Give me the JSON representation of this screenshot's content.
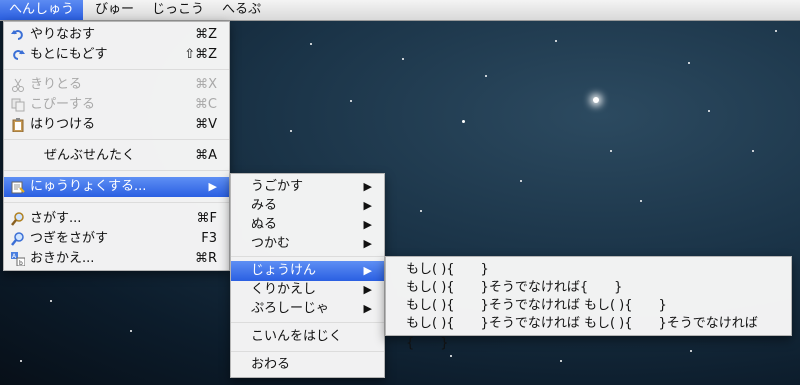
{
  "menubar": [
    "へんしゅう",
    "びゅー",
    "じっこう",
    "へるぷ"
  ],
  "edit_menu": {
    "undo": {
      "label": "やりなおす",
      "shortcut": "⌘Z",
      "icon": "undo-icon"
    },
    "redo": {
      "label": "もとにもどす",
      "shortcut": "⇧⌘Z",
      "icon": "redo-icon"
    },
    "cut": {
      "label": "きりとる",
      "shortcut": "⌘X",
      "icon": "scissors-icon"
    },
    "copy": {
      "label": "こぴーする",
      "shortcut": "⌘C",
      "icon": "copy-icon"
    },
    "paste": {
      "label": "はりつける",
      "shortcut": "⌘V",
      "icon": "clipboard-icon"
    },
    "select_all": {
      "label": "ぜんぶせんたく",
      "shortcut": "⌘A"
    },
    "insert": {
      "label": "にゅうりょくする...",
      "icon": "insert-icon"
    },
    "find": {
      "label": "さがす...",
      "shortcut": "⌘F",
      "icon": "magnifier-icon"
    },
    "find_next": {
      "label": "つぎをさがす",
      "shortcut": "F3",
      "icon": "find-next-icon"
    },
    "replace": {
      "label": "おきかえ...",
      "shortcut": "⌘R",
      "icon": "replace-icon"
    }
  },
  "insert_submenu": {
    "move": "うごかす",
    "look": "みる",
    "paint": "ぬる",
    "grab": "つかむ",
    "condition": "じょうけん",
    "repeat": "くりかえし",
    "procedure": "ぷろしーじゃ",
    "error": "こいんをはじく",
    "end": "おわる"
  },
  "condition_submenu": [
    "もし( ){　　}",
    "もし( ){　　}そうでなければ{　　}",
    "もし( ){　　}そうでなければ もし( ){　　}",
    "もし( ){　　}そうでなければ もし( ){　　}そうでなければ{　　}"
  ],
  "colors": {
    "highlight": "#2f64e3",
    "menu_bg": "#f6f6f6"
  }
}
